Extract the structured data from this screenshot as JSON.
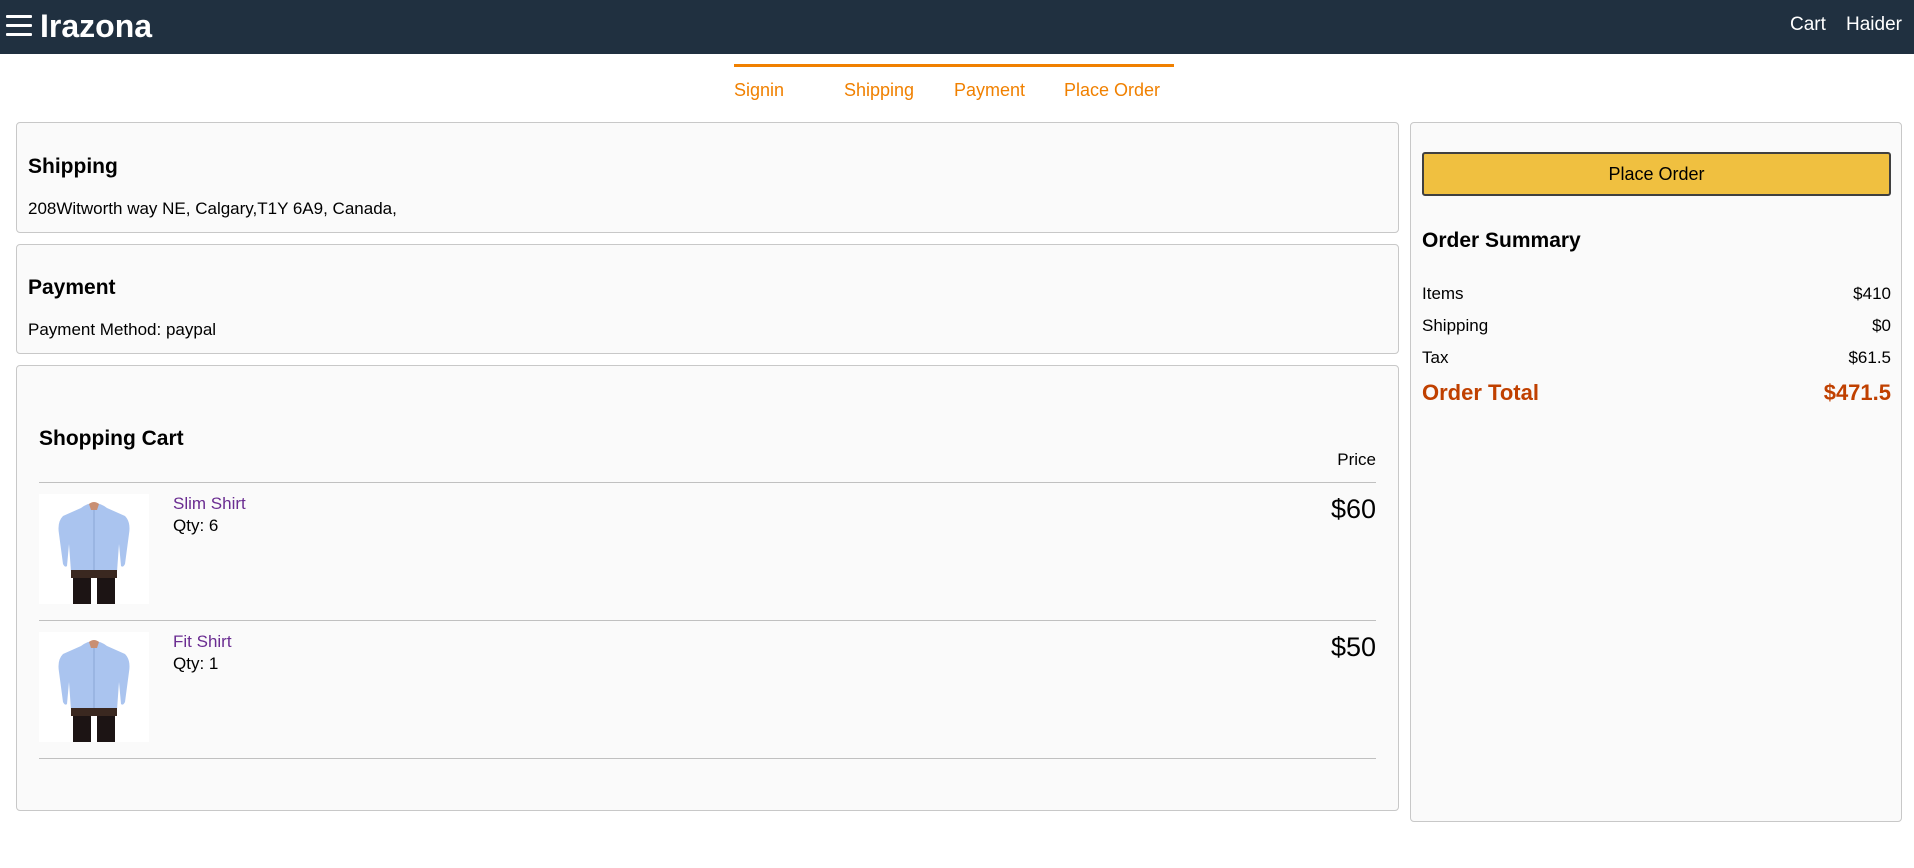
{
  "header": {
    "brand": "Irazona",
    "menu_icon": "hamburger-icon",
    "cart_label": "Cart",
    "user_label": "Haider"
  },
  "steps": {
    "items": [
      "Signin",
      "Shipping",
      "Payment",
      "Place Order"
    ],
    "active_color": "#f08000"
  },
  "shipping": {
    "title": "Shipping",
    "address": "208Witworth way NE, Calgary,T1Y 6A9, Canada,"
  },
  "payment": {
    "title": "Payment",
    "method": "Payment Method: paypal"
  },
  "cart": {
    "title": "Shopping Cart",
    "price_header": "Price",
    "items": [
      {
        "name": "Slim Shirt",
        "qty": "Qty: 6",
        "price": "$60",
        "image": "blue-shirt-image"
      },
      {
        "name": "Fit Shirt",
        "qty": "Qty: 1",
        "price": "$50",
        "image": "blue-shirt-image"
      }
    ]
  },
  "summary": {
    "place_order_label": "Place Order",
    "title": "Order Summary",
    "rows": [
      {
        "label": "Items",
        "value": "$410"
      },
      {
        "label": "Shipping",
        "value": "$0"
      },
      {
        "label": "Tax",
        "value": "$61.5"
      }
    ],
    "total_label": "Order Total",
    "total_value": "$471.5"
  },
  "colors": {
    "header_bg": "#203040",
    "button_bg": "#f0c040",
    "total_color": "#c04000",
    "link_color": "#6a2c91"
  }
}
